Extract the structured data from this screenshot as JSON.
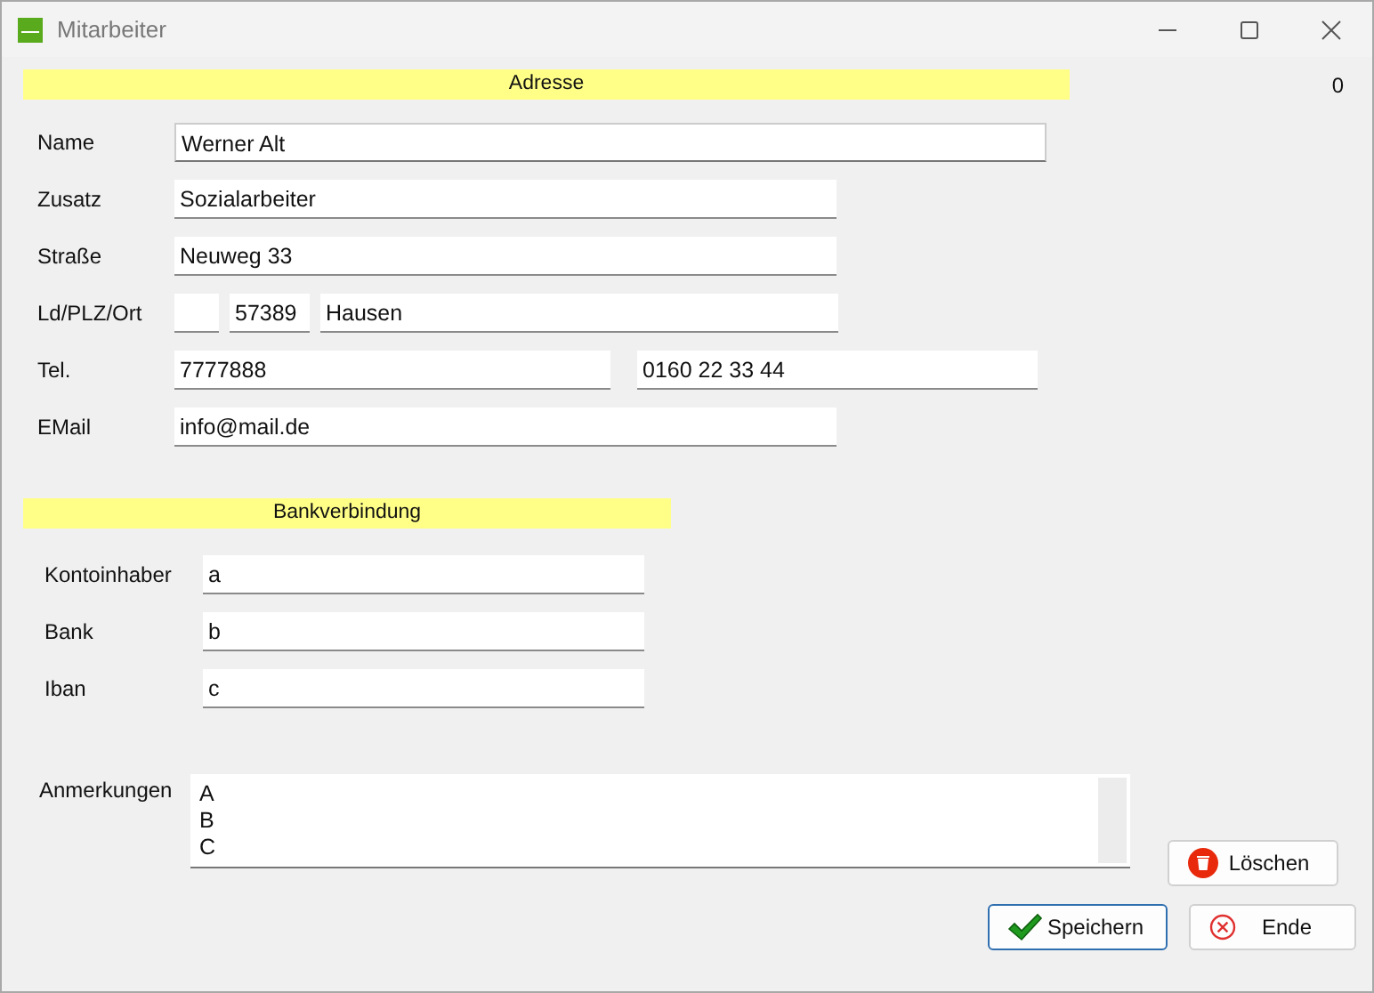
{
  "window": {
    "title": "Mitarbeiter"
  },
  "address": {
    "heading": "Adresse",
    "counter": "0",
    "rows": [
      {
        "label": "Name",
        "fields": [
          {
            "kind": "full",
            "value": "Werner Alt"
          }
        ]
      },
      {
        "label": "Zusatz",
        "fields": [
          {
            "kind": "long",
            "value": "Sozialarbeiter"
          }
        ]
      },
      {
        "label": "Straße",
        "fields": [
          {
            "kind": "long",
            "value": "Neuweg 33"
          }
        ]
      },
      {
        "label": "Ld/PLZ/Ort",
        "fields": [
          {
            "kind": "tiny"
          },
          {
            "kind": "zip",
            "value": "57389"
          },
          {
            "kind": "city",
            "value": "Hausen"
          }
        ]
      },
      {
        "label": "Tel.",
        "fields": [
          {
            "kind": "phone",
            "value": "7777888"
          },
          {
            "kind": "mobile",
            "value": "0160 22 33 44"
          }
        ]
      },
      {
        "label": "EMail",
        "fields": [
          {
            "kind": "long",
            "value": "info@mail.de"
          }
        ]
      }
    ]
  },
  "bank": {
    "heading": "Bankverbindung",
    "rows": [
      {
        "label": "Kontoinhaber",
        "fields": [
          {
            "kind": "bank",
            "value": "a"
          }
        ]
      },
      {
        "label": "Bank",
        "fields": [
          {
            "kind": "bank",
            "value": "b"
          }
        ]
      },
      {
        "label": "Iban",
        "fields": [
          {
            "kind": "bank",
            "value": "c"
          }
        ]
      }
    ]
  },
  "notes": {
    "label": "Anmerkungen",
    "lines": [
      "A",
      "B",
      "C"
    ]
  },
  "buttons": [
    {
      "kind": "delete",
      "label": "Löschen"
    },
    {
      "kind": "save",
      "label": "Speichern",
      "focused": true
    },
    {
      "kind": "close",
      "label": "Ende",
      "focused": false
    }
  ]
}
